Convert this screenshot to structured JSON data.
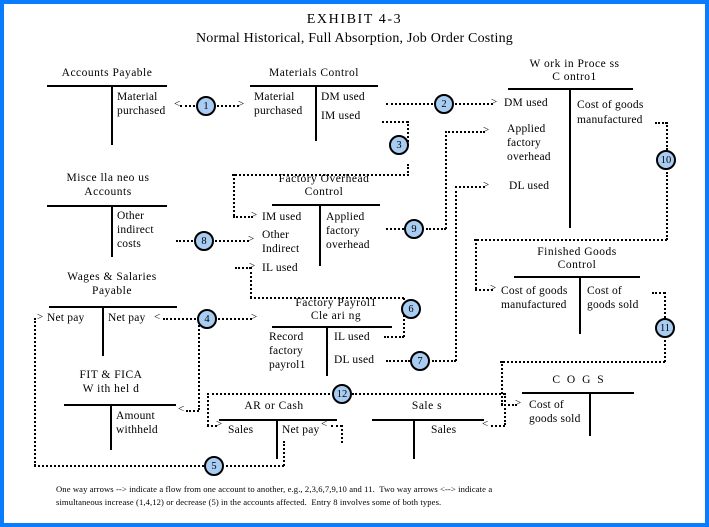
{
  "title": {
    "line1": "EXHIBIT 4-3",
    "line2": "Normal Historical, Full Absorption, Job Order Costing"
  },
  "accounts": [
    {
      "id": "accounts-payable",
      "name": "Accounts Payable",
      "debit": [],
      "credit": [
        "Material",
        "purchased"
      ]
    },
    {
      "id": "materials-control",
      "name": "Materials Control",
      "debit": [
        "Material",
        "purchased"
      ],
      "credit": [
        "DM used",
        "IM used"
      ]
    },
    {
      "id": "work-in-process-control",
      "name": "Work in Process\nControl",
      "debit": [
        "DM used",
        "Applied",
        "factory",
        "overhead",
        "DL used"
      ],
      "credit": [
        "Cost of goods",
        "manufactured"
      ]
    },
    {
      "id": "miscellaneous-accounts",
      "name": "Miscellaneous\nAccounts",
      "debit": [],
      "credit": [
        "Other",
        "indirect",
        "costs"
      ]
    },
    {
      "id": "factory-overhead-control",
      "name": "Factory Overhead\nControl",
      "debit": [
        "IM used",
        "Other",
        "Indirect",
        "IL used"
      ],
      "credit": [
        "Applied",
        "factory",
        "overhead"
      ]
    },
    {
      "id": "finished-goods-control",
      "name": "Finished Goods\nControl",
      "debit": [
        "Cost of goods",
        "manufactured"
      ],
      "credit": [
        "Cost of",
        "goods sold"
      ]
    },
    {
      "id": "wages-salaries-payable",
      "name": "Wages & Salaries\nPayable",
      "debit": [
        "Net pay"
      ],
      "credit": [
        "Net pay"
      ]
    },
    {
      "id": "factory-payroll-clearing",
      "name": "Factory Payroll\nClearing",
      "debit": [
        "Record",
        "factory",
        "payroll"
      ],
      "credit": [
        "IL used",
        "DL used"
      ]
    },
    {
      "id": "fit-fica-withheld",
      "name": "FIT & FICA\nWithheld",
      "debit": [],
      "credit": [
        "Amount",
        "withheld"
      ]
    },
    {
      "id": "ar-or-cash",
      "name": "AR or Cash",
      "debit": [
        "Sales"
      ],
      "credit": [
        "Net pay"
      ]
    },
    {
      "id": "sales",
      "name": "Sales",
      "debit": [],
      "credit": [
        "Sales"
      ]
    },
    {
      "id": "cogs",
      "name": "C O G S",
      "debit": [
        "Cost of",
        "goods sold"
      ],
      "credit": []
    }
  ],
  "labels": {
    "accounts_payable": "Accounts Payable",
    "materials_control": "Materials Control",
    "wip_control_l1": "W ork in Proce ss",
    "wip_control_l2": "C ontro1",
    "misc_accounts_l1": "Misce lla neo us",
    "misc_accounts_l2": "Accounts",
    "foh_control_l1": "Factory Overhead",
    "foh_control_l2": "Control",
    "finished_goods_l1": "Finished Goods",
    "finished_goods_l2": "Control",
    "wages_payable_l1": "Wages & Salaries",
    "wages_payable_l2": "Payable",
    "payroll_clearing_l1": "Factory Payrol1",
    "payroll_clearing_l2": "Cle ari ng",
    "fit_fica_l1": "FIT & FICA",
    "fit_fica_l2": "W ith hel d",
    "ar_or_cash": "AR or Cash",
    "sales": "Sale s",
    "cogs": "C O G S",
    "material_purchased_1": "Material",
    "material_purchased_2": "purchased",
    "material_purchased_3": "Material",
    "material_purchased_4": "purchased",
    "dm_used_mc": "DM used",
    "im_used_mc": "IM used",
    "dm_used_wip": "DM used",
    "applied_foh_wip_1": "Applied",
    "applied_foh_wip_2": "factory",
    "applied_foh_wip_3": "overhead",
    "dl_used_wip": "DL used",
    "cogm_wip_1": "Cost of goods",
    "cogm_wip_2": "manufactured",
    "other_indirect_costs_1": "Other",
    "other_indirect_costs_2": "indirect",
    "other_indirect_costs_3": "costs",
    "im_used_foh": "IM used",
    "other_indirect_foh_1": "Other",
    "other_indirect_foh_2": "Indirect",
    "il_used_foh": "IL used",
    "applied_foh_1": "Applied",
    "applied_foh_2": "factory",
    "applied_foh_3": "overhead",
    "cogm_fg_1": "Cost of goods",
    "cogm_fg_2": "manufactured",
    "cogs_fg_1": "Cost of",
    "cogs_fg_2": "goods sold",
    "net_pay_debit": "Net pay",
    "net_pay_credit": "Net pay",
    "record_payroll_1": "Record",
    "record_payroll_2": "factory",
    "record_payroll_3": "payrol1",
    "il_used_fpc": "IL used",
    "dl_used_fpc": "DL used",
    "amount_withheld_1": "Amount",
    "amount_withheld_2": "withheld",
    "sales_ar_debit": "Sales",
    "net_pay_ar_credit": "Net pay",
    "sales_credit": "Sales",
    "cogs_debit_1": "Cost of",
    "cogs_debit_2": "goods sold"
  },
  "entries": [
    {
      "n": "1",
      "desc": "material purchased, AP to Materials Control"
    },
    {
      "n": "2",
      "desc": "DM used, Materials Control to WIP"
    },
    {
      "n": "3",
      "desc": "IM used, Materials Control to Factory Overhead Control"
    },
    {
      "n": "4",
      "desc": "net pay, Wages & Salaries Payable to Factory Payroll Clearing"
    },
    {
      "n": "5",
      "desc": "amount withheld, FIT & FICA Withheld"
    },
    {
      "n": "6",
      "desc": "IL used, Factory Payroll Clearing to Factory Overhead Control"
    },
    {
      "n": "7",
      "desc": "DL used, Factory Payroll Clearing to WIP"
    },
    {
      "n": "8",
      "desc": "other indirect costs, Miscellaneous Accounts to Factory Overhead Control"
    },
    {
      "n": "9",
      "desc": "applied factory overhead, Factory Overhead Control to WIP"
    },
    {
      "n": "10",
      "desc": "cost of goods manufactured, WIP to Finished Goods Control"
    },
    {
      "n": "11",
      "desc": "cost of goods sold, Finished Goods Control to COGS"
    },
    {
      "n": "12",
      "desc": "sales, AR or Cash and Sales"
    }
  ],
  "footnote": {
    "line1": "One way arrows --> indicate a flow from one account to another, e.g., 2,3,6,7,9,10 and 11.  Two way arrows <--> indicate a",
    "line2": "simultaneous increase (1,4,12) or decrease (5) in the accounts affected.  Entry 8 involves some of both types."
  },
  "colors": {
    "border": "#0a7cff",
    "circle_fill": "#a9cdf2",
    "ink": "#000000"
  }
}
